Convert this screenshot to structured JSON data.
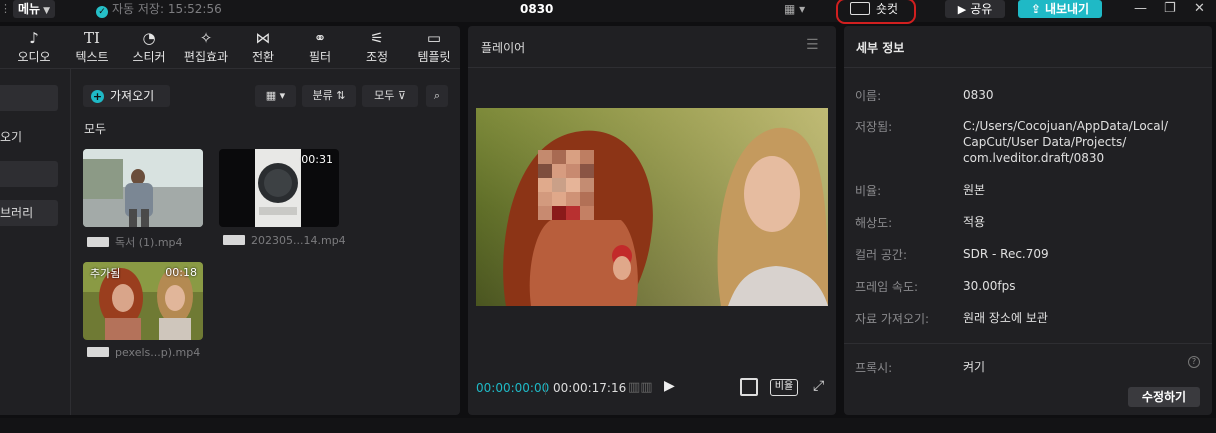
{
  "topbar": {
    "menu_label": "메뉴",
    "autosave_label": "자동 저장: 15:52:56",
    "project_title": "0830",
    "shortcut_label": "숏컷",
    "share_label": "공유",
    "export_label": "내보내기"
  },
  "tools": [
    {
      "label": "오디오",
      "icon": "audio-icon"
    },
    {
      "label": "텍스트",
      "icon": "text-icon"
    },
    {
      "label": "스티커",
      "icon": "sticker-icon"
    },
    {
      "label": "편집효과",
      "icon": "effects-icon"
    },
    {
      "label": "전환",
      "icon": "transition-icon"
    },
    {
      "label": "필터",
      "icon": "filter-icon"
    },
    {
      "label": "조정",
      "icon": "adjust-icon"
    },
    {
      "label": "템플릿",
      "icon": "template-icon"
    }
  ],
  "leftnav": [
    {
      "label": ""
    },
    {
      "label": "오기"
    },
    {
      "label": ""
    },
    {
      "label": "브러리"
    }
  ],
  "media": {
    "import_label": "가져오기",
    "sort_label": "분류",
    "filter_label": "모두",
    "section_title": "모두",
    "items": [
      {
        "filename": "독서 (1).mp4",
        "duration": "",
        "added": ""
      },
      {
        "filename": "202305...14.mp4",
        "duration": "00:31",
        "added": ""
      },
      {
        "filename": "pexels...p).mp4",
        "duration": "00:18",
        "added": "추가됨"
      }
    ]
  },
  "player": {
    "title": "플레이어",
    "current_time": "00:00:00:00",
    "total_time": "00:00:17:16",
    "ratio_label": "비율"
  },
  "info": {
    "title": "세부 정보",
    "rows": [
      {
        "label": "이름:",
        "value": "0830"
      },
      {
        "label": "저장됨:",
        "value": "C:/Users/Cocojuan/AppData/Local/"
      },
      {
        "label": "비율:",
        "value": "원본"
      },
      {
        "label": "해상도:",
        "value": "적용"
      },
      {
        "label": "컬러 공간:",
        "value": "SDR - Rec.709"
      },
      {
        "label": "프레임 속도:",
        "value": "30.00fps"
      },
      {
        "label": "자료 가져오기:",
        "value": "원래 장소에 보관"
      }
    ],
    "path_line2": "CapCut/User Data/Projects/",
    "path_line3": "com.lveditor.draft/0830",
    "proxy_label": "프록시:",
    "proxy_value": "켜기",
    "edit_label": "수정하기"
  },
  "colors": {
    "accent": "#1fb9c6",
    "highlight": "#d11f1f"
  }
}
